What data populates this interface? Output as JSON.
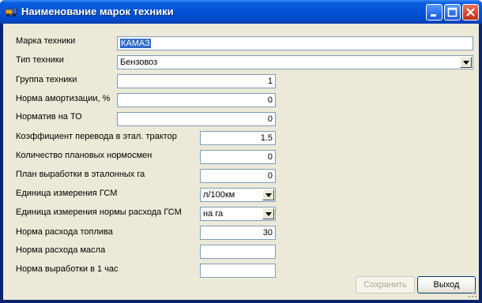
{
  "window": {
    "title": "Наименование марок техники"
  },
  "form": {
    "brand": {
      "label": "Марка техники",
      "value": "КАМАЗ"
    },
    "type": {
      "label": "Тип техники",
      "value": "Бензовоз"
    },
    "group": {
      "label": "Группа техники",
      "value": "1"
    },
    "depreciation": {
      "label": "Норма амортизации, %",
      "value": "0"
    },
    "maintenance": {
      "label": "Норматив на ТО",
      "value": "0"
    },
    "tractor_coef": {
      "label": "Коэффициент перевода в этал. трактор",
      "value": "1.5"
    },
    "planned_shifts": {
      "label": "Количество плановых нормосмен",
      "value": "0"
    },
    "output_plan": {
      "label": "План выработки в эталонных га",
      "value": "0"
    },
    "fuel_unit": {
      "label": "Единица измерения ГСМ",
      "value": "л/100км"
    },
    "fuel_norm_unit": {
      "label": "Единица измерения нормы расхода ГСМ",
      "value": "на га"
    },
    "fuel_rate": {
      "label": "Норма расхода топлива",
      "value": "30"
    },
    "oil_rate": {
      "label": "Норма расхода масла",
      "value": ""
    },
    "hourly_output": {
      "label": "Норма выработки в 1 час",
      "value": ""
    }
  },
  "buttons": {
    "save": "Сохранить",
    "exit": "Выход"
  },
  "colors": {
    "titlebar": "#0453d8",
    "dialog_bg": "#ece9d8",
    "selection": "#316ac5",
    "field_border": "#7f9db9"
  }
}
